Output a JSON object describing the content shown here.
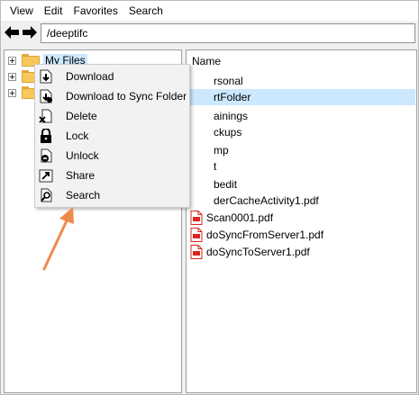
{
  "menubar": {
    "items": [
      {
        "label": "View"
      },
      {
        "label": "Edit"
      },
      {
        "label": "Favorites"
      },
      {
        "label": "Search"
      }
    ]
  },
  "address": {
    "back_icon": "back-arrow-icon",
    "forward_icon": "forward-arrow-icon",
    "path": "/deeptifc"
  },
  "tree": {
    "root_label": "My Files"
  },
  "list": {
    "column_name": "Name",
    "items": [
      {
        "name": "rsonal",
        "icon": "folder-icon"
      },
      {
        "name": "rtFolder",
        "icon": "folder-icon",
        "selected": true
      },
      {
        "name": "ainings",
        "icon": "folder-icon"
      },
      {
        "name": "ckups",
        "icon": "folder-icon"
      },
      {
        "name": "mp",
        "icon": "folder-icon"
      },
      {
        "name": "t",
        "icon": "folder-icon"
      },
      {
        "name": "bedit",
        "icon": "folder-icon"
      },
      {
        "name": "derCacheActivity1.pdf",
        "icon": "pdf-icon"
      },
      {
        "name": "Scan0001.pdf",
        "icon": "pdf-icon"
      },
      {
        "name": "doSyncFromServer1.pdf",
        "icon": "pdf-icon"
      },
      {
        "name": "doSyncToServer1.pdf",
        "icon": "pdf-icon"
      }
    ]
  },
  "context_menu": {
    "items": [
      {
        "label": "Download",
        "icon": "download-icon"
      },
      {
        "label": "Download to Sync Folder",
        "icon": "download-sync-icon"
      },
      {
        "label": "Delete",
        "icon": "delete-icon"
      },
      {
        "label": "Lock",
        "icon": "lock-icon"
      },
      {
        "label": "Unlock",
        "icon": "unlock-icon"
      },
      {
        "label": "Share",
        "icon": "share-icon"
      },
      {
        "label": "Search",
        "icon": "search-icon"
      }
    ]
  },
  "colors": {
    "annotation_arrow": "#f08a4b",
    "selection": "#cce8ff",
    "folder": "#f6c95b",
    "pdf_red": "#d9261c"
  }
}
